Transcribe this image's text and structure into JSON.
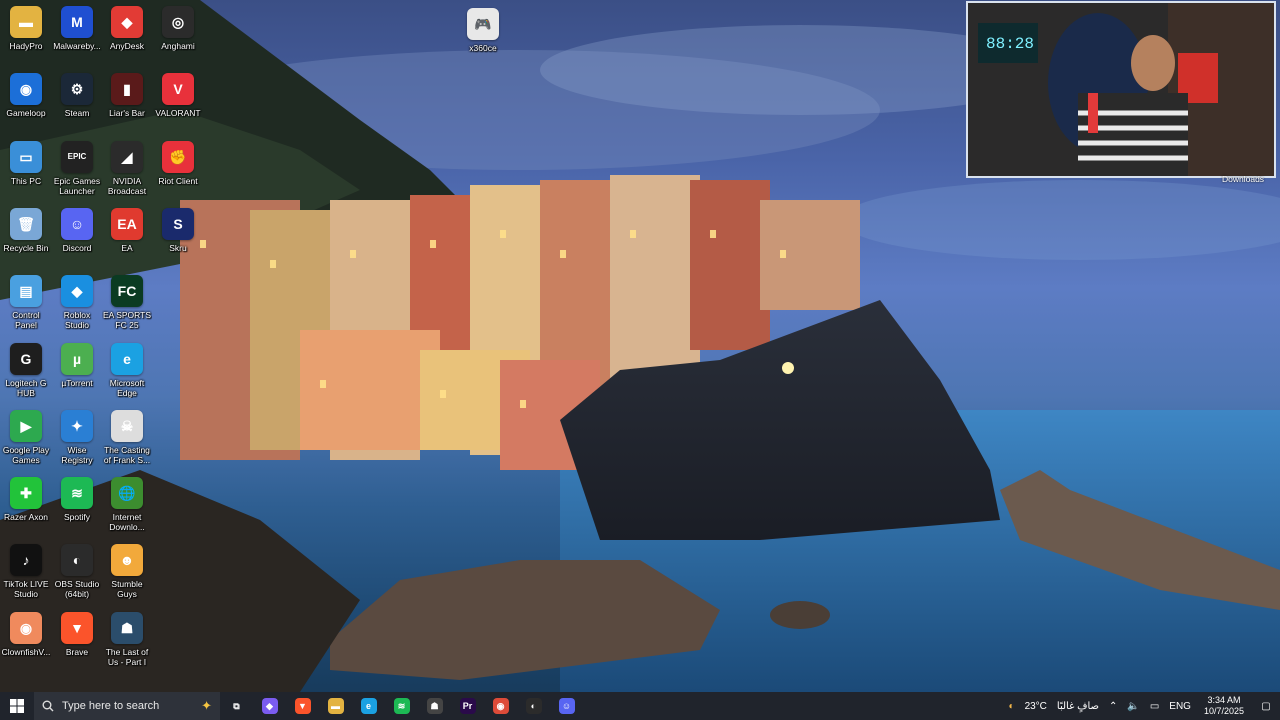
{
  "desktop": {
    "icons": [
      {
        "label": "HadyPro",
        "icon": "folder-icon",
        "color": "#e3b341",
        "glyph": "▬"
      },
      {
        "label": "Malwareby...",
        "icon": "malwarebytes-icon",
        "color": "#1f4fd1",
        "glyph": "M"
      },
      {
        "label": "AnyDesk",
        "icon": "anydesk-icon",
        "color": "#e23b35",
        "glyph": "◆"
      },
      {
        "label": "Anghami",
        "icon": "anghami-icon",
        "color": "#2b2b2b",
        "glyph": "◎"
      },
      {
        "label": "Gameloop",
        "icon": "gameloop-icon",
        "color": "#1c6fd8",
        "glyph": "◉"
      },
      {
        "label": "Steam",
        "icon": "steam-icon",
        "color": "#1b2838",
        "glyph": "⚙"
      },
      {
        "label": "Liar's Bar",
        "icon": "liars-bar-icon",
        "color": "#5a1a1a",
        "glyph": "▮"
      },
      {
        "label": "VALORANT",
        "icon": "valorant-icon",
        "color": "#e8313b",
        "glyph": "V"
      },
      {
        "label": "This PC",
        "icon": "this-pc-icon",
        "color": "#3a8fd8",
        "glyph": "▭"
      },
      {
        "label": "Epic Games Launcher",
        "icon": "epic-games-icon",
        "color": "#222222",
        "glyph": "EPIC"
      },
      {
        "label": "NVIDIA Broadcast",
        "icon": "nvidia-icon",
        "color": "#2b2b2b",
        "glyph": "◢"
      },
      {
        "label": "Riot Client",
        "icon": "riot-client-icon",
        "color": "#e8313b",
        "glyph": "✊"
      },
      {
        "label": "Recycle Bin",
        "icon": "recycle-bin-icon",
        "color": "#7aa7d6",
        "glyph": "🗑"
      },
      {
        "label": "Discord",
        "icon": "discord-icon",
        "color": "#5865f2",
        "glyph": "☺"
      },
      {
        "label": "EA",
        "icon": "ea-icon",
        "color": "#e03a2f",
        "glyph": "EA"
      },
      {
        "label": "Skru",
        "icon": "skru-icon",
        "color": "#1a2a6c",
        "glyph": "S"
      },
      {
        "label": "Control Panel",
        "icon": "control-panel-icon",
        "color": "#4aa0e0",
        "glyph": "▤"
      },
      {
        "label": "Roblox Studio",
        "icon": "roblox-studio-icon",
        "color": "#1a8fe0",
        "glyph": "◆"
      },
      {
        "label": "EA SPORTS FC 25",
        "icon": "ea-sports-fc-icon",
        "color": "#0b3b22",
        "glyph": "FC"
      },
      {
        "label": "",
        "icon": "blank-icon",
        "color": "transparent",
        "glyph": ""
      },
      {
        "label": "Logitech G HUB",
        "icon": "logitech-ghub-icon",
        "color": "#1e1e1e",
        "glyph": "G"
      },
      {
        "label": "µTorrent",
        "icon": "utorrent-icon",
        "color": "#4caf50",
        "glyph": "µ"
      },
      {
        "label": "Microsoft Edge",
        "icon": "edge-icon",
        "color": "#1ba1e2",
        "glyph": "e"
      },
      {
        "label": "",
        "icon": "blank-icon",
        "color": "transparent",
        "glyph": ""
      },
      {
        "label": "Google Play Games",
        "icon": "google-play-games-icon",
        "color": "#2da94f",
        "glyph": "▶"
      },
      {
        "label": "Wise Registry Cleaner",
        "icon": "wise-registry-icon",
        "color": "#2a7fd4",
        "glyph": "✦"
      },
      {
        "label": "The Casting of Frank S...",
        "icon": "casting-frank-icon",
        "color": "#dddddd",
        "glyph": "☠"
      },
      {
        "label": "",
        "icon": "blank-icon",
        "color": "transparent",
        "glyph": ""
      },
      {
        "label": "Razer Axon",
        "icon": "razer-axon-icon",
        "color": "#22c33a",
        "glyph": "✚"
      },
      {
        "label": "Spotify",
        "icon": "spotify-icon",
        "color": "#1db954",
        "glyph": "≋"
      },
      {
        "label": "Internet Downlo...",
        "icon": "idm-icon",
        "color": "#3c8d2f",
        "glyph": "🌐"
      },
      {
        "label": "",
        "icon": "blank-icon",
        "color": "transparent",
        "glyph": ""
      },
      {
        "label": "TikTok LIVE Studio",
        "icon": "tiktok-live-icon",
        "color": "#111111",
        "glyph": "♪"
      },
      {
        "label": "OBS Studio (64bit)",
        "icon": "obs-icon",
        "color": "#2b2b2b",
        "glyph": "◐"
      },
      {
        "label": "Stumble Guys",
        "icon": "stumble-guys-icon",
        "color": "#f2a93b",
        "glyph": "☻"
      },
      {
        "label": "",
        "icon": "blank-icon",
        "color": "transparent",
        "glyph": ""
      },
      {
        "label": "ClownfishV...",
        "icon": "clownfish-icon",
        "color": "#f08a5d",
        "glyph": "◉"
      },
      {
        "label": "Brave",
        "icon": "brave-icon",
        "color": "#fb542b",
        "glyph": "▼"
      },
      {
        "label": "The Last of Us - Part I",
        "icon": "last-of-us-icon",
        "color": "#2b4d6b",
        "glyph": "☗"
      }
    ],
    "top_file": {
      "label": "x360ce",
      "icon": "x360ce-icon",
      "color": "#e8e8e8",
      "glyph": "🎮"
    }
  },
  "webcam": {
    "extra_label": "Downloads"
  },
  "taskbar": {
    "search_placeholder": "Type here to search",
    "apps": [
      {
        "name": "task-view-icon",
        "glyph": "⧉",
        "color": "transparent"
      },
      {
        "name": "copilot-icon",
        "glyph": "◆",
        "color": "#7b5cf0"
      },
      {
        "name": "brave-taskbar-icon",
        "glyph": "▼",
        "color": "#fb542b"
      },
      {
        "name": "file-explorer-icon",
        "glyph": "▬",
        "color": "#e3b341"
      },
      {
        "name": "edge-taskbar-icon",
        "glyph": "e",
        "color": "#1ba1e2"
      },
      {
        "name": "spotify-taskbar-icon",
        "glyph": "≋",
        "color": "#1db954"
      },
      {
        "name": "game-taskbar-icon",
        "glyph": "☗",
        "color": "#444444"
      },
      {
        "name": "premiere-icon",
        "glyph": "Pr",
        "color": "#2a0a4a"
      },
      {
        "name": "chrome-icon",
        "glyph": "◉",
        "color": "#dd4b39"
      },
      {
        "name": "obs-taskbar-icon",
        "glyph": "◐",
        "color": "#2b2b2b"
      },
      {
        "name": "discord-taskbar-icon",
        "glyph": "☺",
        "color": "#5865f2"
      }
    ],
    "weather": "23°C",
    "weather_desc": "صافٍ غالبًا",
    "language": "ENG",
    "time": "3:34 AM",
    "date": "10/7/2025"
  }
}
